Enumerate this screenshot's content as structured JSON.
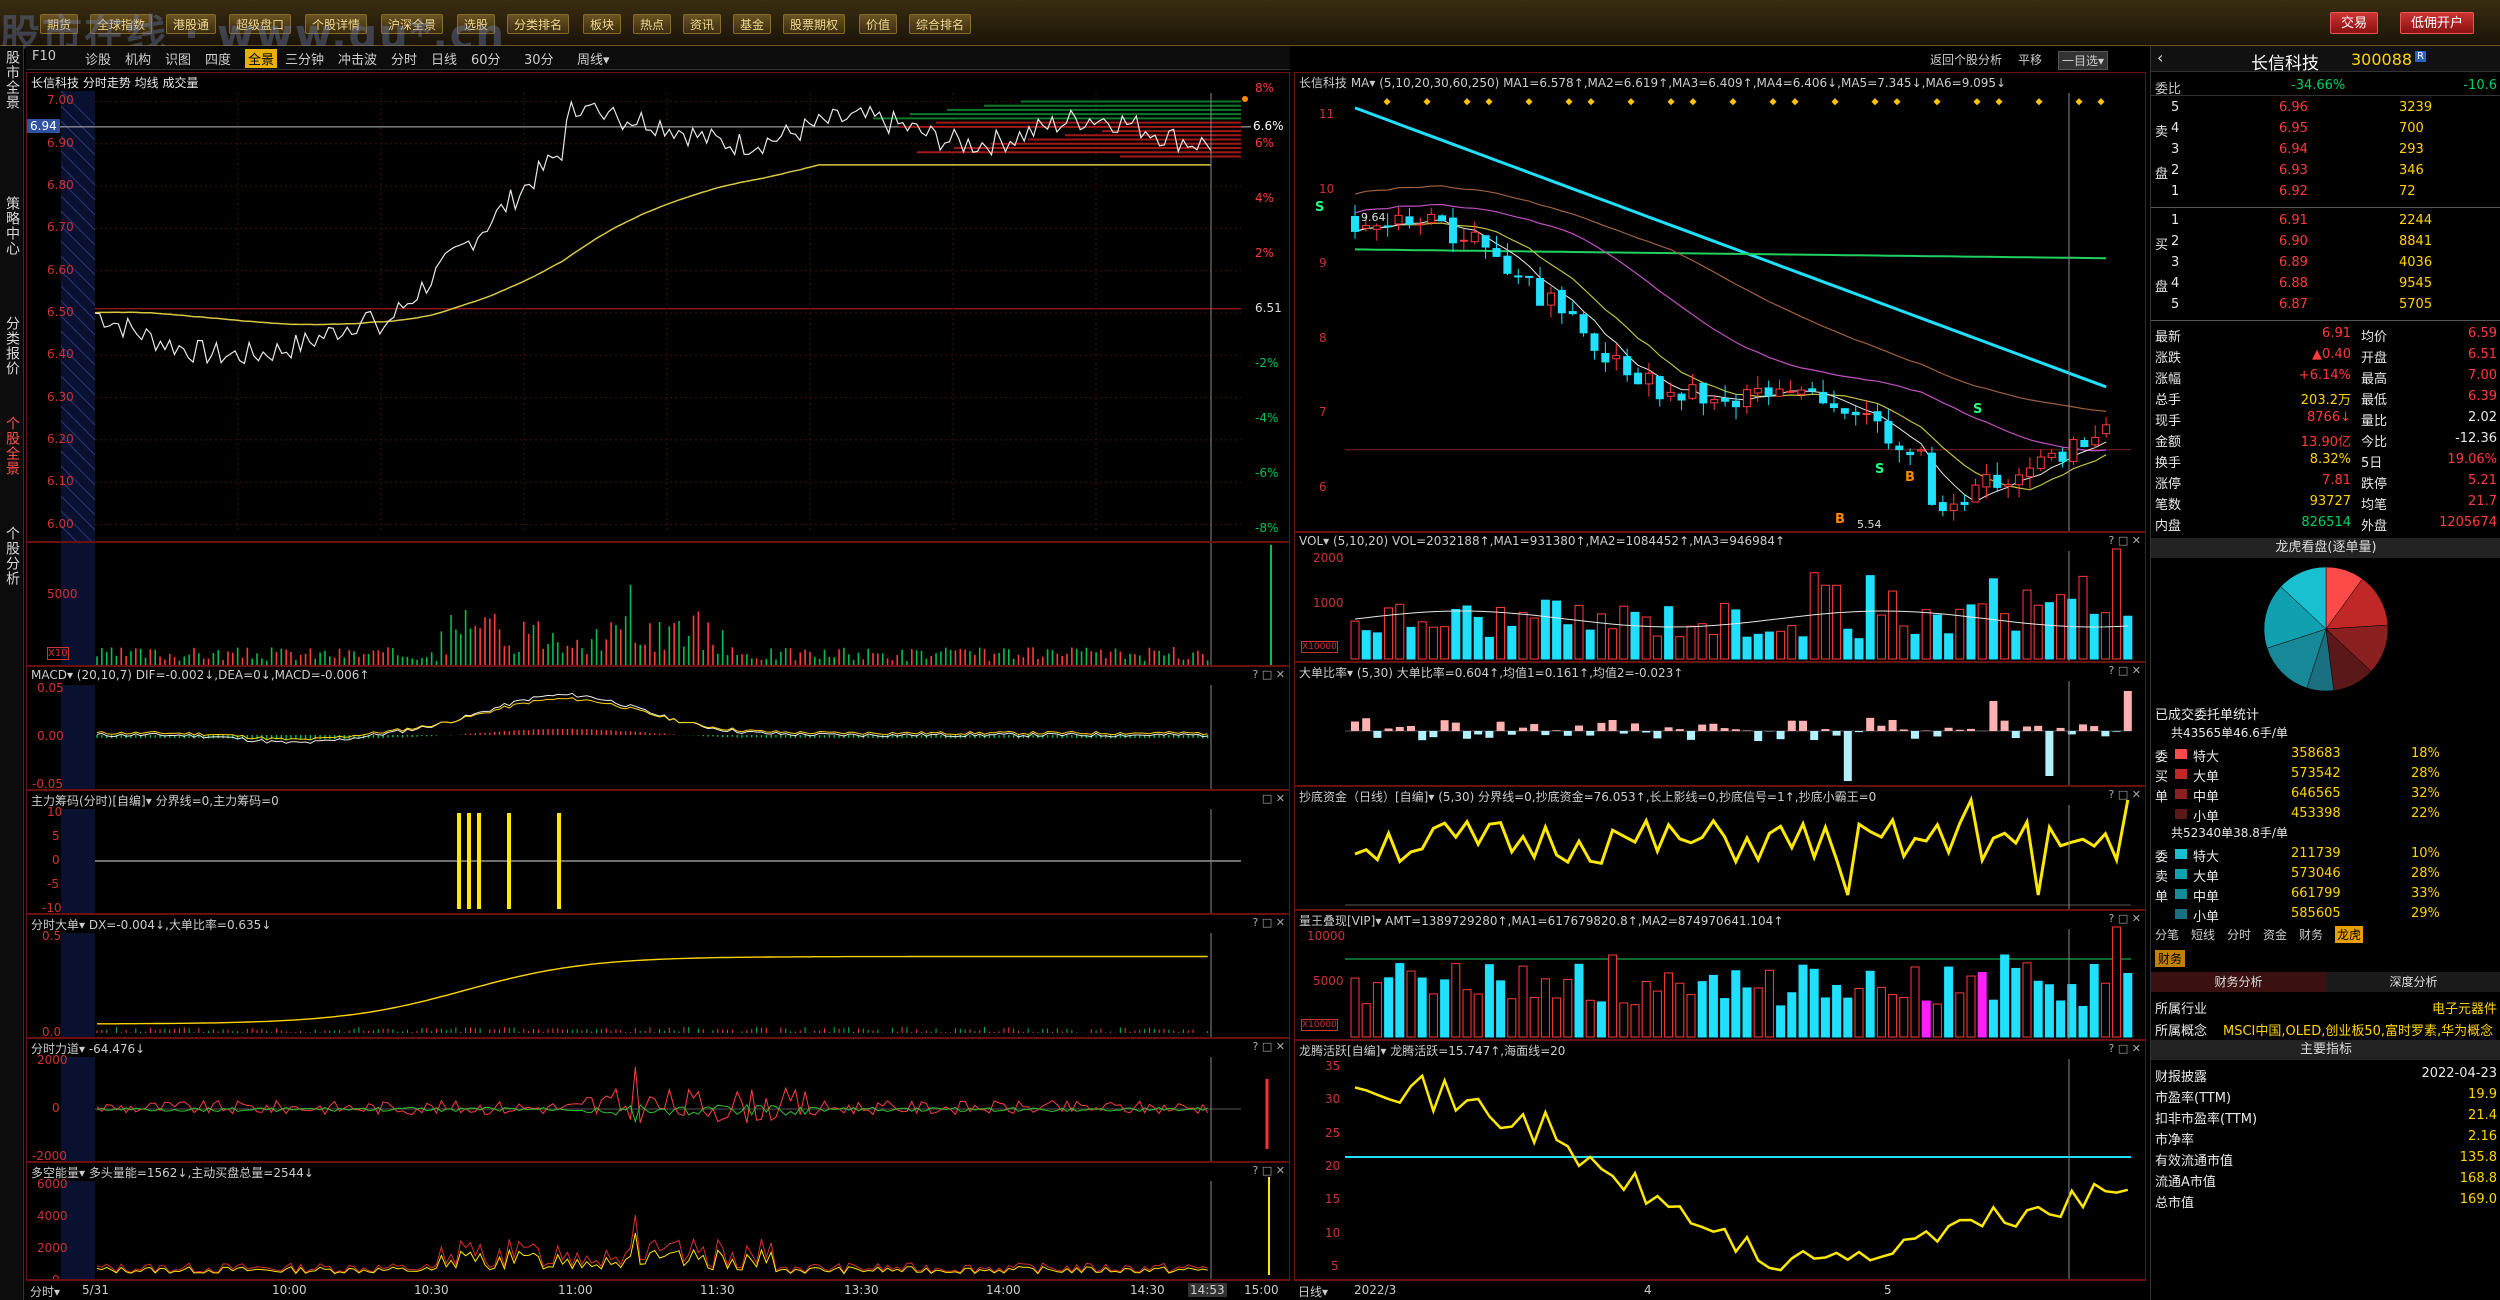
{
  "window": {
    "watermark": "股市在线 · www.gu*.cn"
  },
  "topbar": {
    "buttons": [
      "期货",
      "全球指数",
      "港股通",
      "超级盘口",
      "个股详情",
      "沪深全景",
      "选股",
      "分类排名",
      "板块",
      "热点",
      "资讯",
      "基金",
      "股票期权",
      "价值",
      "综合排名"
    ],
    "trade": "交易",
    "open_account": "低佣开户"
  },
  "lefttabs": [
    "股市全景",
    "策略中心",
    "分类报价",
    "个股全景",
    "个股分析"
  ],
  "subbar": {
    "items": [
      "F10",
      "诊股",
      "机构",
      "识图",
      "四度",
      "全景",
      "三分钟",
      "冲击波",
      "分时",
      "日线",
      "60分",
      "30分",
      "周线▾"
    ],
    "active_index": 5
  },
  "intraday": {
    "title": "长信科技  分时走势  均线  成交量",
    "current_price": "6.94",
    "current_pct": "6.6%",
    "last_label": "6.51",
    "price_levels": [
      "7.00",
      "6.90",
      "6.80",
      "6.70",
      "6.60",
      "6.50",
      "6.40",
      "6.30",
      "6.20",
      "6.10",
      "6.00"
    ],
    "pct_levels": [
      "8%",
      "6%",
      "4%",
      "2%",
      "-2%",
      "-4%",
      "-6%",
      "-8%"
    ],
    "vol_label": "5000",
    "vol_unit": "X10",
    "macd_title": "MACD▾  (20,10,7)  DIF=-0.002↓,DEA=0↓,MACD=-0.006↑",
    "macd_levels": [
      "0.05",
      "0.00",
      "-0.05"
    ],
    "main_title": "主力筹码(分时)[自编]▾  分界线=0,主力筹码=0",
    "main_levels": [
      "10",
      "5",
      "0",
      "-5",
      "-10"
    ],
    "big_title": "分时大单▾  DX=-0.004↓,大单比率=0.635↓",
    "big_levels": [
      "0.5",
      "0.0"
    ],
    "force_title": "分时力道▾  -64.476↓",
    "force_levels": [
      "2000",
      "0",
      "-2000"
    ],
    "energy_title": "多空能量▾  多头量能=1562↓,主动买盘总量=2544↓",
    "energy_levels": [
      "6000",
      "4000",
      "2000",
      "0"
    ],
    "x_labels": [
      "5/31",
      "10:00",
      "10:30",
      "11:00",
      "11:30",
      "13:30",
      "14:00",
      "14:30",
      "14:53",
      "15:00"
    ],
    "x_left": "分时▾"
  },
  "daily": {
    "title": "长信科技  MA▾  (5,10,20,30,60,250)  MA1=6.578↑,MA2=6.619↑,MA3=6.409↑,MA4=6.406↓,MA5=7.345↓,MA6=9.095↓",
    "price_levels": [
      "11",
      "10",
      "9",
      "8",
      "7",
      "6"
    ],
    "high_label": "9.64",
    "low_label": "5.54",
    "vol_title": "VOL▾  (5,10,20)  VOL=2032188↑,MA1=931380↑,MA2=1084452↑,MA3=946984↑",
    "vol_levels": [
      "2000",
      "1000",
      "X10000"
    ],
    "ratio_title": "大单比率▾  (5,30)  大单比率=0.604↑,均值1=0.161↑,均值2=-0.023↑",
    "bottom_title": "抄底资金（日线）[自编]▾  (5,30)  分界线=0,抄底资金=76.053↑,长上影线=0,抄底信号=1↑,抄底小霸王=0",
    "amt_title": "量王叠现[VIP]▾  AMT=1389729280↑,MA1=617679820.8↑,MA2=874970641.104↑",
    "amt_levels": [
      "10000",
      "5000",
      "X10000"
    ],
    "dragon_title": "龙腾活跃[自编]▾  龙腾活跃=15.747↑,海面线=20",
    "dragon_levels": [
      "35",
      "30",
      "25",
      "20",
      "15",
      "10",
      "5"
    ],
    "x_labels": [
      "2022/3",
      "4",
      "5"
    ],
    "x_left": "日线▾",
    "top_right": [
      "返回个股分析",
      "平移",
      "一目选▾"
    ]
  },
  "info": {
    "name": "长信科技",
    "code": "300088",
    "wei_label": "委比",
    "wei_value": "-34.66%",
    "wei_diff": "-10.6",
    "sell": [
      {
        "lvl": "5",
        "price": "6.96",
        "vol": "3239"
      },
      {
        "lvl": "4",
        "price": "6.95",
        "vol": "700"
      },
      {
        "lvl": "3",
        "price": "6.94",
        "vol": "293"
      },
      {
        "lvl": "2",
        "price": "6.93",
        "vol": "346"
      },
      {
        "lvl": "1",
        "price": "6.92",
        "vol": "72"
      }
    ],
    "buy": [
      {
        "lvl": "1",
        "price": "6.91",
        "vol": "2244"
      },
      {
        "lvl": "2",
        "price": "6.90",
        "vol": "8841"
      },
      {
        "lvl": "3",
        "price": "6.89",
        "vol": "4036"
      },
      {
        "lvl": "4",
        "price": "6.88",
        "vol": "9545"
      },
      {
        "lvl": "5",
        "price": "6.87",
        "vol": "5705"
      }
    ],
    "stats": [
      {
        "l": "最新",
        "v": "6.91",
        "l2": "均价",
        "v2": "6.59"
      },
      {
        "l": "涨跌",
        "v": "▲0.40",
        "l2": "开盘",
        "v2": "6.51"
      },
      {
        "l": "涨幅",
        "v": "+6.14%",
        "l2": "最高",
        "v2": "7.00"
      },
      {
        "l": "总手",
        "v": "203.2万",
        "l2": "最低",
        "v2": "6.39"
      },
      {
        "l": "现手",
        "v": "8766↓",
        "l2": "量比",
        "v2": "2.02"
      },
      {
        "l": "金额",
        "v": "13.90亿",
        "l2": "今比",
        "v2": "-12.36"
      },
      {
        "l": "换手",
        "v": "8.32%",
        "l2": "5日",
        "v2": "19.06%"
      },
      {
        "l": "涨停",
        "v": "7.81",
        "l2": "跌停",
        "v2": "5.21"
      },
      {
        "l": "笔数",
        "v": "93727",
        "l2": "均笔",
        "v2": "21.7"
      },
      {
        "l": "内盘",
        "v": "826514",
        "l2": "外盘",
        "v2": "1205674"
      }
    ],
    "pie_title": "龙虎看盘(逐单量)",
    "order_title": "已成交委托单统计",
    "buy_summary": "共43565单46.6手/单",
    "buy_rows": [
      {
        "s": "委",
        "k": "特大",
        "v": "358683",
        "p": "18%"
      },
      {
        "s": "买",
        "k": "大单",
        "v": "573542",
        "p": "28%"
      },
      {
        "s": "单",
        "k": "中单",
        "v": "646565",
        "p": "32%"
      },
      {
        "s": "",
        "k": "小单",
        "v": "453398",
        "p": "22%"
      }
    ],
    "sell_summary": "共52340单38.8手/单",
    "sell_rows": [
      {
        "s": "委",
        "k": "特大",
        "v": "211739",
        "p": "10%"
      },
      {
        "s": "卖",
        "k": "大单",
        "v": "573046",
        "p": "28%"
      },
      {
        "s": "单",
        "k": "中单",
        "v": "661799",
        "p": "33%"
      },
      {
        "s": "",
        "k": "小单",
        "v": "585605",
        "p": "29%"
      }
    ],
    "tabs": [
      "分笔",
      "短线",
      "分时",
      "资金",
      "财务",
      "龙虎"
    ],
    "finance_tab": "财务",
    "fin_tabs": [
      "财务分析",
      "深度分析"
    ],
    "industry_label": "所属行业",
    "industry": "电子元器件",
    "concept_label": "所属概念",
    "concept": "MSCI中国,OLED,创业板50,富时罗素,华为概念",
    "main_index": "主要指标",
    "fin_rows": [
      {
        "l": "财报披露",
        "v": "2022-04-23"
      },
      {
        "l": "市盈率(TTM)",
        "v": "19.9"
      },
      {
        "l": "扣非市盈率(TTM)",
        "v": "21.4"
      },
      {
        "l": "市净率",
        "v": "2.16"
      },
      {
        "l": "有效流通市值",
        "v": "135.8"
      },
      {
        "l": "流通A市值",
        "v": "168.8"
      },
      {
        "l": "总市值",
        "v": "169.0"
      }
    ]
  }
}
